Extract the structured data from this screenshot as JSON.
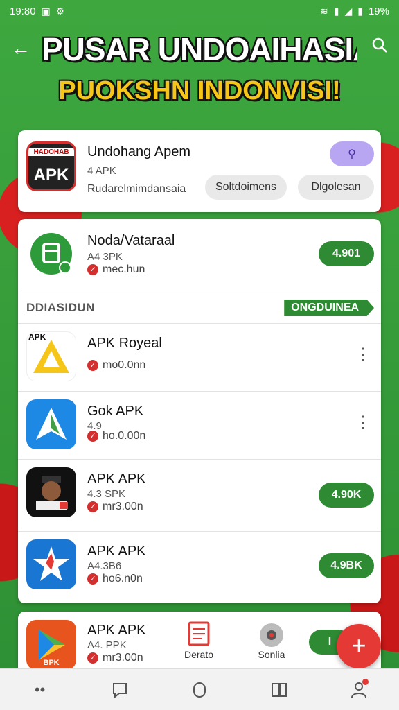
{
  "status_bar": {
    "time": "19:80",
    "battery": "19%"
  },
  "header": {
    "title": "PUSAR UNDOAIHASIA",
    "subtitle": "PUOKSHN INDONVISI!"
  },
  "featured": {
    "name": "Undohang Apem",
    "meta": "4 APK",
    "developer": "Rudarelmimdansaia",
    "icon_text": "APK",
    "icon_top_text": "HADOHAB",
    "actions": [
      "Soltdoimens",
      "Dlgolesan"
    ]
  },
  "top_app": {
    "name": "Noda/Vataraal",
    "meta": "A4 3PK",
    "developer": "mec.hun",
    "button": "4.901"
  },
  "section": {
    "label": "DDIASIDUN",
    "tag": "ONGDUINEA"
  },
  "apps": [
    {
      "name": "APK Royeal",
      "meta": "",
      "developer": "mo0.0nn",
      "icon_label": "APK",
      "action": ""
    },
    {
      "name": "Gok APK",
      "meta": "4.9",
      "developer": "ho.0.00n",
      "action": ""
    },
    {
      "name": "APK APK",
      "meta": "4.3 SPK",
      "developer": "mr3.00n",
      "action": "4.90K"
    },
    {
      "name": "APK APK",
      "meta": "A4.3B6",
      "developer": "ho6.n0n",
      "action": "4.9BK"
    }
  ],
  "bottom_app": {
    "name": "APK APK",
    "meta": "A4. PPK",
    "developer": "mr3.00n",
    "icon_label": "BPK",
    "button": "I"
  },
  "mid_nav": [
    {
      "label": "Derato"
    },
    {
      "label": "Sonlia"
    }
  ],
  "fab_label": "+",
  "colors": {
    "accent_green": "#2e8b34",
    "accent_red": "#e53935",
    "title_yellow": "#f5c518"
  }
}
